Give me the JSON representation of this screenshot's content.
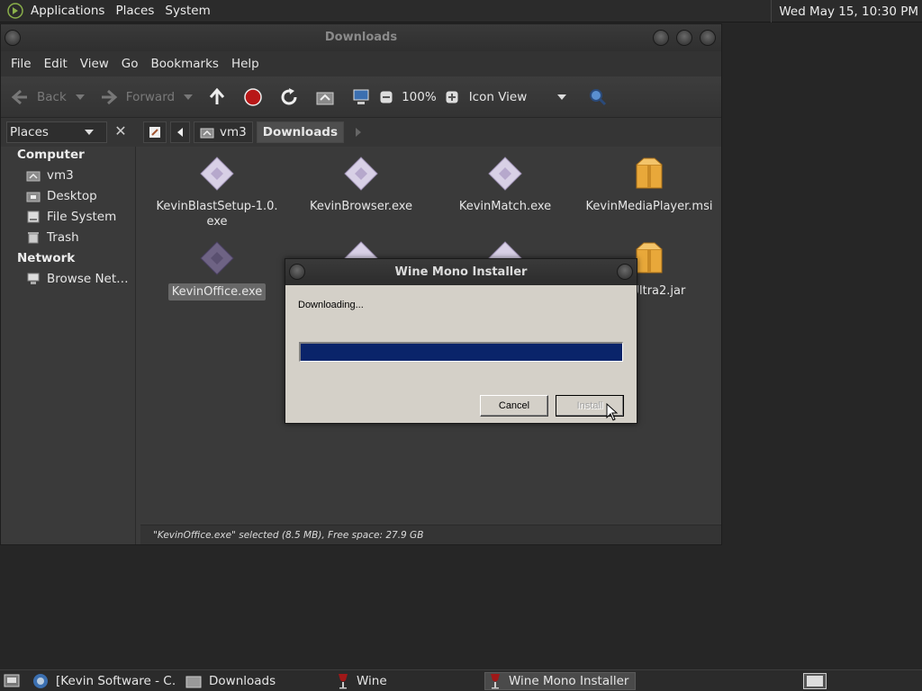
{
  "top_panel": {
    "menus": [
      "Applications",
      "Places",
      "System"
    ],
    "clock": "Wed May 15, 10:30 PM"
  },
  "file_manager": {
    "title": "Downloads",
    "menubar": [
      "File",
      "Edit",
      "View",
      "Go",
      "Bookmarks",
      "Help"
    ],
    "toolbar": {
      "back": "Back",
      "forward": "Forward",
      "zoom": "100%",
      "view_mode": "Icon View"
    },
    "sidebar_selector": "Places",
    "breadcrumbs": [
      "vm3",
      "Downloads"
    ],
    "sidebar": {
      "computer_heading": "Computer",
      "computer_items": [
        "vm3",
        "Desktop",
        "File System",
        "Trash"
      ],
      "network_heading": "Network",
      "network_items": [
        "Browse Net…"
      ]
    },
    "files": [
      {
        "name": "KevinBlastSetup-1.0.\nexe",
        "icon": "wine-exe-icon"
      },
      {
        "name": "KevinBrowser.exe",
        "icon": "wine-exe-icon"
      },
      {
        "name": "KevinMatch.exe",
        "icon": "wine-exe-icon"
      },
      {
        "name": "KevinMediaPlayer.msi",
        "icon": "package-icon"
      },
      {
        "name": "KevinOffice.exe",
        "icon": "wine-exe-icon",
        "selected": true
      },
      {
        "name": "",
        "icon": "wine-exe-icon"
      },
      {
        "name": "",
        "icon": "wine-exe-icon"
      },
      {
        "name": "astUltra2.jar",
        "icon": "package-icon"
      }
    ],
    "status": "\"KevinOffice.exe\" selected (8.5 MB), Free space: 27.9 GB"
  },
  "dialog": {
    "title": "Wine Mono Installer",
    "message": "Downloading...",
    "progress": 1.0,
    "cancel_label": "Cancel",
    "install_label": "Install"
  },
  "taskbar": {
    "tasks": [
      "[Kevin Software - C…",
      "Downloads",
      "Wine",
      "Wine Mono Installer"
    ]
  },
  "colors": {
    "progress_fill": "#0a246a",
    "dialog_body": "#d4d0c8",
    "selection": "#686868"
  }
}
